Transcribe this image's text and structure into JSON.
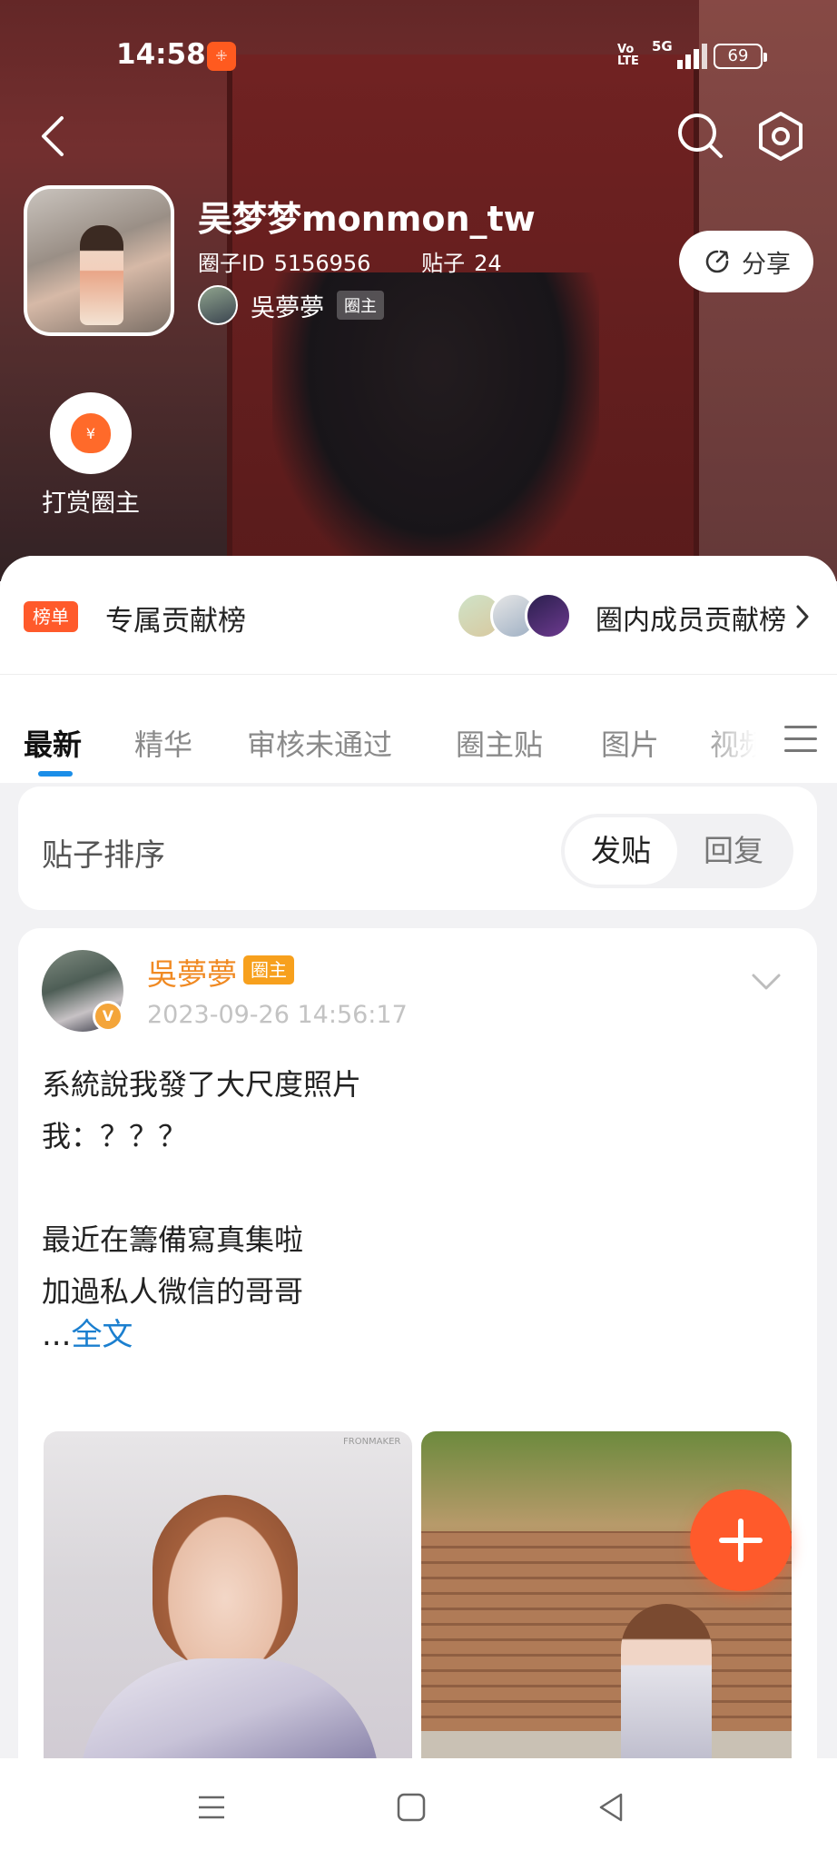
{
  "status_bar": {
    "time": "14:58",
    "app_badge": "ꔰ",
    "volte": "Vo\nLTE",
    "network": "5G",
    "battery": "69"
  },
  "header": {
    "circle_name": "吴梦梦monmon_tw",
    "circle_id_label": "圈子ID",
    "circle_id": "5156956",
    "posts_label": "贴子",
    "posts_count": "24",
    "owner_name": "吳夢夢",
    "owner_tag": "圈主",
    "share_label": "分享",
    "reward_label": "打赏圈主",
    "reward_symbol": "¥"
  },
  "ranking": {
    "tag": "榜单",
    "title": "专属贡献榜",
    "link_label": "圈内成员贡献榜"
  },
  "tabs": [
    {
      "label": "最新",
      "active": true
    },
    {
      "label": "精华",
      "active": false
    },
    {
      "label": "审核未通过",
      "active": false
    },
    {
      "label": "圈主贴",
      "active": false
    },
    {
      "label": "图片",
      "active": false
    },
    {
      "label": "视频",
      "active": false
    }
  ],
  "sort": {
    "label": "贴子排序",
    "option_selected": "发贴",
    "option_other": "回复"
  },
  "post": {
    "author": "吳夢夢",
    "author_tag": "圈主",
    "verified_badge": "V",
    "time": "2023-09-26 14:56:17",
    "lines": [
      "系統說我發了大尺度照片",
      "我：？？？",
      "",
      "最近在籌備寫真集啦",
      "加過私人微信的哥哥"
    ],
    "more_prefix": "...",
    "more_link": "全文",
    "photo_watermark": "FRONMAKER"
  },
  "icons": {
    "back": "back-arrow-icon",
    "search": "search-icon",
    "settings": "hexagon-settings-icon",
    "share": "share-icon",
    "reward": "money-bag-icon",
    "fab": "plus-icon"
  },
  "colors": {
    "accent_orange": "#ff5a2b",
    "owner_name": "#f08a23",
    "tab_indicator": "#1b8ee8",
    "link_blue": "#1b7fcf"
  }
}
